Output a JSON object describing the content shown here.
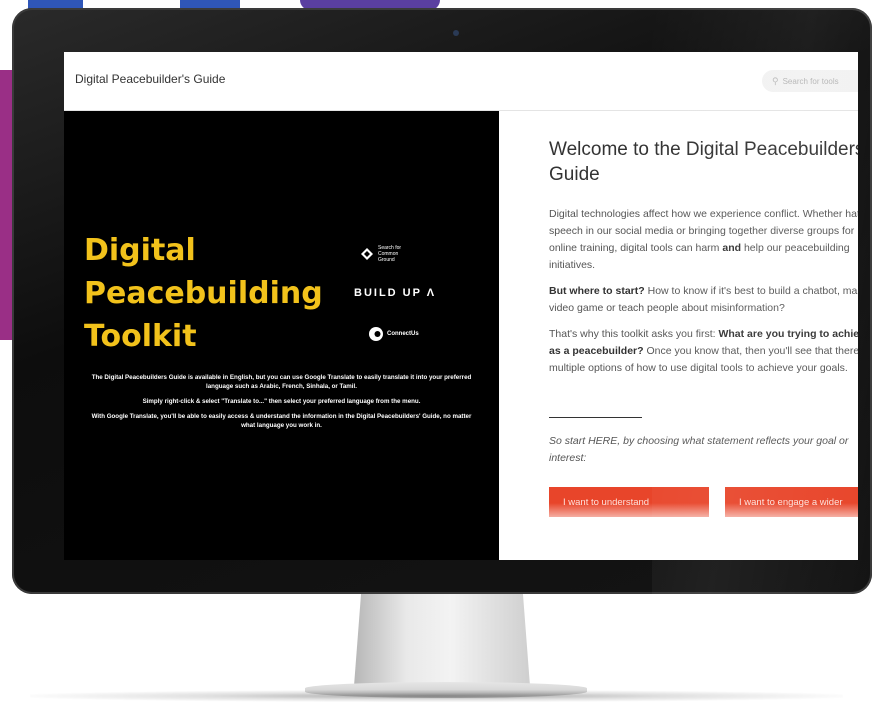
{
  "site": {
    "title": "Digital Peacebuilder's Guide",
    "search_placeholder": "Search for tools"
  },
  "hero": {
    "title_lines": [
      "Digital",
      "Peacebuilding",
      "Toolkit"
    ],
    "logos": {
      "sfcg": "Search for Common Ground",
      "buildup": "BUILD UP Λ",
      "connectus": "ConnectUs"
    },
    "paragraphs": [
      "The Digital Peacebuilders Guide is available in English, but you can use Google Translate to easily translate it into your preferred language such as Arabic, French, Sinhala, or Tamil.",
      "Simply right-click & select \"Translate to...\" then select your preferred language from the menu.",
      "With Google Translate, you'll be able to easily access & understand the information in the Digital Peacebuilders' Guide, no matter what language you work in."
    ]
  },
  "content": {
    "welcome": "Welcome to the Digital Peacebuilders Guide",
    "p1_a": "Digital technologies affect how we experience conflict. Whether hate speech in our social media or bringing together diverse groups for online training, digital tools can harm ",
    "p1_bold": "and",
    "p1_b": " help our peacebuilding initiatives.",
    "p2_bold": "But where to start?",
    "p2_rest": " How to know if it's best to build a chatbot, make a video game or teach people about misinformation?",
    "p3_a": "That's why this toolkit asks you first: ",
    "p3_bold": "What are you trying to achieve as a peacebuilder?",
    "p3_b": " Once you know that, then you'll see that there are multiple options of how to use digital tools to achieve your goals.",
    "p4": "So start HERE, by choosing what statement reflects your goal or interest:",
    "button1": "I want to understand",
    "button2": "I want to engage a wider"
  },
  "colors": {
    "hero_title": "#f2c21b",
    "button": "#e8452a",
    "hero_bg": "#000000"
  }
}
